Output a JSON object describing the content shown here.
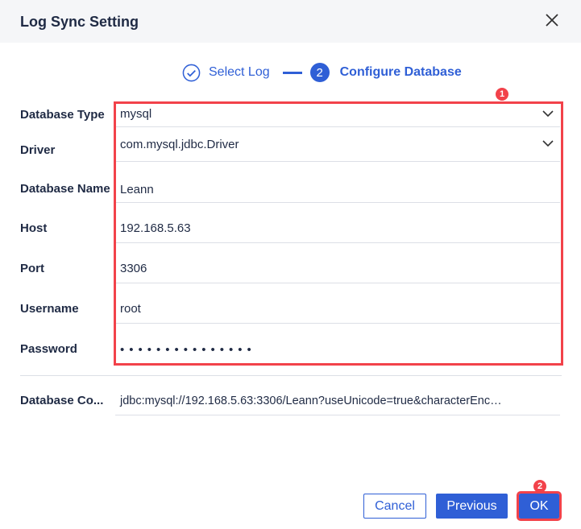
{
  "dialog": {
    "title": "Log Sync Setting"
  },
  "steps": [
    {
      "label": "Select Log",
      "state": "done"
    },
    {
      "number": "2",
      "label": "Configure Database",
      "state": "active"
    }
  ],
  "form": {
    "database_type": {
      "label": "Database Type",
      "value": "mysql"
    },
    "driver": {
      "label": "Driver",
      "value": "com.mysql.jdbc.Driver"
    },
    "database_name": {
      "label": "Database Name",
      "value": "Leann"
    },
    "host": {
      "label": "Host",
      "value": "192.168.5.63"
    },
    "port": {
      "label": "Port",
      "value": "3306"
    },
    "username": {
      "label": "Username",
      "value": "root"
    },
    "password": {
      "label": "Password",
      "value": "•••••••••••••••"
    },
    "connection": {
      "label": "Database Co...",
      "value": "jdbc:mysql://192.168.5.63:3306/Leann?useUnicode=true&characterEnc…"
    }
  },
  "annotations": {
    "one": "1",
    "two": "2"
  },
  "buttons": {
    "cancel": "Cancel",
    "previous": "Previous",
    "ok": "OK"
  },
  "colors": {
    "accent": "#2f5fd6",
    "highlight": "#f2424a"
  }
}
